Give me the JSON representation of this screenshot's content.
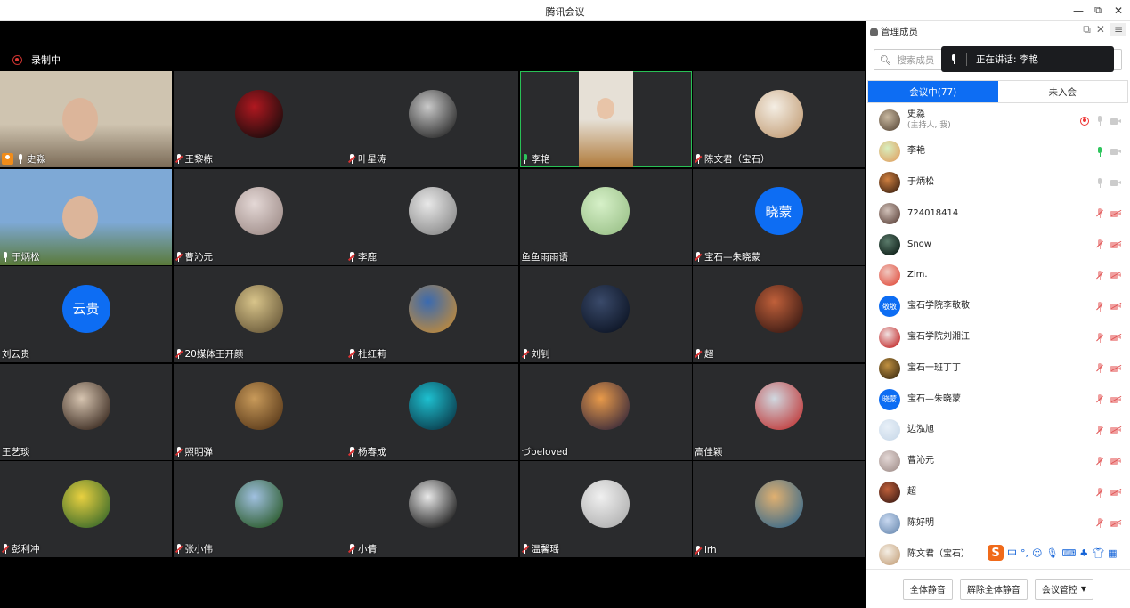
{
  "window": {
    "title": "腾讯会议",
    "minimize": "—",
    "restore": "⧉",
    "close": "✕"
  },
  "recording": {
    "label": "录制中"
  },
  "tiles": [
    {
      "name": "史淼",
      "type": "video",
      "host": true,
      "mic": "on",
      "colors": [
        "#cfc4b0",
        "#7b6b57"
      ]
    },
    {
      "name": "王黎栋",
      "type": "avatar",
      "mic": "off",
      "colors": [
        "#b01820",
        "#1a0c0c"
      ]
    },
    {
      "name": "叶星涛",
      "type": "avatar",
      "mic": "off",
      "colors": [
        "#c9c9c9",
        "#2a2a2a"
      ]
    },
    {
      "name": "李艳",
      "type": "video",
      "speaking": true,
      "mic": "on",
      "colors": [
        "#e6e0d6",
        "#b07a3a"
      ]
    },
    {
      "name": "陈文君（宝石）",
      "type": "avatar",
      "mic": "off",
      "colors": [
        "#f4eee4",
        "#c4a07a"
      ]
    },
    {
      "name": "于炳松",
      "type": "video",
      "mic": "on",
      "colors": [
        "#7ea9d6",
        "#5a7a3a"
      ]
    },
    {
      "name": "曹沁元",
      "type": "avatar",
      "mic": "off",
      "colors": [
        "#e4d8d6",
        "#a08e8a"
      ]
    },
    {
      "name": "李鹿",
      "type": "avatar",
      "mic": "off",
      "colors": [
        "#e8e8e8",
        "#8a8a8a"
      ]
    },
    {
      "name": "鱼鱼雨雨语",
      "type": "avatar",
      "mic": "none",
      "colors": [
        "#d6f0c8",
        "#9cc28a"
      ]
    },
    {
      "name": "宝石—朱晓蒙",
      "type": "text",
      "avatar_text": "晓蒙",
      "mic": "off"
    },
    {
      "name": "刘云贵",
      "type": "text",
      "avatar_text": "云贵",
      "mic": "none"
    },
    {
      "name": "20媒体王开颜",
      "type": "avatar",
      "mic": "off",
      "colors": [
        "#d8c48a",
        "#6a5a3a"
      ]
    },
    {
      "name": "杜红莉",
      "type": "avatar",
      "mic": "off",
      "colors": [
        "#3a6ab0",
        "#c08a3a"
      ]
    },
    {
      "name": "刘钊",
      "type": "avatar",
      "mic": "off",
      "colors": [
        "#3a4a6a",
        "#0c1424"
      ]
    },
    {
      "name": "超",
      "type": "avatar",
      "mic": "off",
      "colors": [
        "#c0603a",
        "#3a1a14"
      ]
    },
    {
      "name": "王艺琰",
      "type": "avatar",
      "mic": "none",
      "colors": [
        "#d6c4b0",
        "#3a2a20"
      ]
    },
    {
      "name": "照明弹",
      "type": "avatar",
      "mic": "off",
      "colors": [
        "#c89a5a",
        "#5a3a1a"
      ]
    },
    {
      "name": "杨春成",
      "type": "avatar",
      "mic": "off",
      "colors": [
        "#1ec0d0",
        "#0a3a4a"
      ]
    },
    {
      "name": "づbeloved",
      "type": "avatar",
      "mic": "none",
      "colors": [
        "#e89a4a",
        "#3a2a3a"
      ]
    },
    {
      "name": "高佳颖",
      "type": "avatar",
      "mic": "none",
      "colors": [
        "#d0d8e0",
        "#c03a3a"
      ]
    },
    {
      "name": "彭利冲",
      "type": "avatar",
      "mic": "off",
      "colors": [
        "#e8d040",
        "#3a6a2a"
      ]
    },
    {
      "name": "张小伟",
      "type": "avatar",
      "mic": "off",
      "colors": [
        "#a0c0e0",
        "#2a5a2a"
      ]
    },
    {
      "name": "小倩",
      "type": "avatar",
      "mic": "off",
      "colors": [
        "#e8e8e8",
        "#1a1a1a"
      ]
    },
    {
      "name": "温馨瑶",
      "type": "avatar",
      "mic": "off",
      "colors": [
        "#f0f0f0",
        "#b0b0b0"
      ]
    },
    {
      "name": "lrh",
      "type": "avatar",
      "mic": "off",
      "colors": [
        "#e0b070",
        "#3a6a8a"
      ]
    }
  ],
  "panel": {
    "title": "管理成员",
    "search_placeholder": "搜索成员",
    "speaking_label": "正在讲话: 李艳",
    "tabs": [
      {
        "label": "会议中(77)",
        "active": true
      },
      {
        "label": "未入会",
        "active": false
      }
    ],
    "members": [
      {
        "name": "史淼",
        "sub": "(主持人, 我)",
        "mic": "idle",
        "cam": "idle",
        "rec": true,
        "colors": [
          "#c8b8a0",
          "#5a4a3a"
        ]
      },
      {
        "name": "李艳",
        "mic": "on",
        "cam": "idle",
        "colors": [
          "#d8f0c0",
          "#e0a060"
        ]
      },
      {
        "name": "于炳松",
        "mic": "idle",
        "cam": "idle",
        "colors": [
          "#d08040",
          "#3a2010"
        ]
      },
      {
        "name": "724018414",
        "mic": "off",
        "cam": "off",
        "colors": [
          "#d0c0b8",
          "#5a4038"
        ]
      },
      {
        "name": "Snow",
        "mic": "off",
        "cam": "off",
        "colors": [
          "#5a7a6a",
          "#0a1a14"
        ]
      },
      {
        "name": "Zim.",
        "mic": "off",
        "cam": "off",
        "colors": [
          "#f0c8c0",
          "#e04a3a"
        ]
      },
      {
        "name": "宝石学院李敬敬",
        "mic": "off",
        "cam": "off",
        "avatar_text": "敬敬"
      },
      {
        "name": "宝石学院刘湘江",
        "mic": "off",
        "cam": "off",
        "colors": [
          "#f0e0e0",
          "#c02020"
        ]
      },
      {
        "name": "宝石一班丁丁",
        "mic": "off",
        "cam": "off",
        "colors": [
          "#c09040",
          "#3a2a10"
        ]
      },
      {
        "name": "宝石—朱晓蒙",
        "mic": "off",
        "cam": "off",
        "avatar_text": "晓蒙"
      },
      {
        "name": "边泓旭",
        "mic": "off",
        "cam": "off",
        "colors": [
          "#e8f0f8",
          "#c8d8e8"
        ]
      },
      {
        "name": "曹沁元",
        "mic": "off",
        "cam": "off",
        "colors": [
          "#e4d8d6",
          "#a08e8a"
        ]
      },
      {
        "name": "超",
        "mic": "off",
        "cam": "off",
        "colors": [
          "#c0603a",
          "#3a1a14"
        ]
      },
      {
        "name": "陈好明",
        "mic": "off",
        "cam": "off",
        "colors": [
          "#c8d8f0",
          "#6a8ab0"
        ]
      },
      {
        "name": "陈文君（宝石）",
        "mic": "off",
        "cam": "off",
        "colors": [
          "#f4eee4",
          "#c4a07a"
        ]
      }
    ],
    "buttons": {
      "mute_all": "全体静音",
      "unmute_all": "解除全体静音",
      "control": "会议管控"
    }
  },
  "ime": {
    "lang": "中"
  }
}
